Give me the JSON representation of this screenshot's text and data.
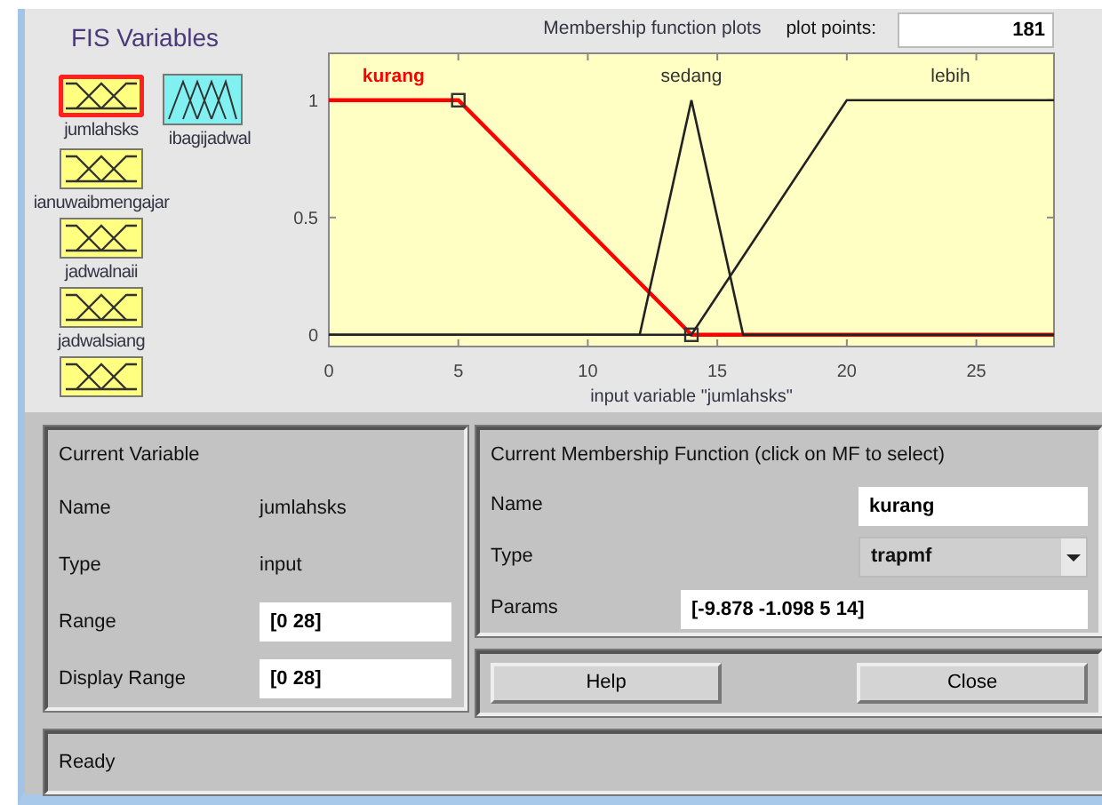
{
  "fis_title": "FIS Variables",
  "fis_variables": [
    {
      "name": "jumlahsks",
      "kind": "input",
      "selected": true
    },
    {
      "name": "ibagijadwal",
      "kind": "output",
      "selected": false
    },
    {
      "name": "ianuwaibmengajar",
      "kind": "input",
      "selected": false
    },
    {
      "name": "jadwalnaii",
      "kind": "input",
      "selected": false
    },
    {
      "name": "jadwalsiang",
      "kind": "input",
      "selected": false
    },
    {
      "kind": "input",
      "selected": false
    }
  ],
  "plot": {
    "plot_points_label": "plot points:",
    "plot_points": "181",
    "mfs": [
      {
        "selected": true
      },
      {
        "selected": false
      },
      {
        "selected": false
      }
    ],
    "chart_data": {
      "type": "line",
      "title": "Membership function plots",
      "xlabel": "input variable \"jumlahsks\"",
      "x": [
        0,
        5,
        12,
        14,
        16,
        20,
        28
      ],
      "xlim": [
        0,
        28
      ],
      "ylim": [
        -0.05,
        1.2
      ],
      "xticks": [
        0,
        5,
        10,
        15,
        20,
        25
      ],
      "yticks": [
        0,
        0.5,
        1
      ],
      "series": [
        {
          "name": "kurang",
          "color": "#ff0000",
          "values": [
            1,
            1,
            0.222,
            0,
            0,
            0,
            0
          ]
        },
        {
          "name": "sedang",
          "color": "#222222",
          "values": [
            0,
            0,
            0,
            1,
            0,
            0,
            0
          ]
        },
        {
          "name": "lebih",
          "color": "#222222",
          "values": [
            0,
            0,
            0,
            0,
            0.333,
            1,
            1
          ]
        }
      ]
    }
  },
  "current_variable": {
    "title": "Current Variable",
    "rows": [
      {
        "label": "Name",
        "value": "jumlahsks",
        "kind": "text"
      },
      {
        "label": "Type",
        "value": "input",
        "kind": "text"
      },
      {
        "label": "Range",
        "value": "[0 28]",
        "kind": "field"
      },
      {
        "label": "Display Range",
        "value": "[0 28]",
        "kind": "field"
      }
    ]
  },
  "current_mf": {
    "title": "Current Membership Function (click on MF to select)",
    "rows": [
      {
        "label": "Name",
        "value": "kurang",
        "kind": "field"
      },
      {
        "label": "Type",
        "value": "trapmf",
        "kind": "popup"
      },
      {
        "label": "Params",
        "value": "[-9.878 -1.098 5 14]",
        "kind": "wide_field"
      }
    ]
  },
  "buttons": [
    "Help",
    "Close"
  ],
  "status": "Ready"
}
